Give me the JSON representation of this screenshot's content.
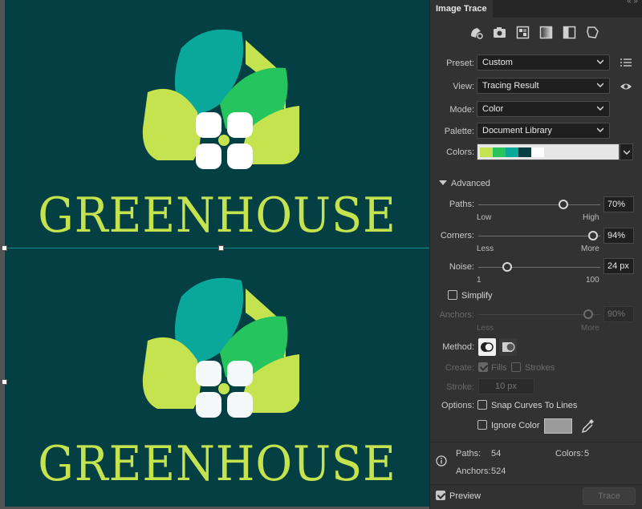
{
  "artwork": {
    "logo_text_top": "GREENHOUSE",
    "logo_text_bottom": "GREENHOUSE",
    "colors": {
      "background": "#033f43",
      "teal": "#0aa79b",
      "green": "#25c45d",
      "lime": "#c5e34f",
      "light_green": "#5dd66a",
      "white": "#ffffff"
    }
  },
  "panel": {
    "title": "Image Trace",
    "presets": [
      "auto-color-icon",
      "high-fidelity-photo-icon",
      "low-fidelity-photo-icon",
      "grayscale-icon",
      "black-and-white-icon",
      "outline-icon"
    ],
    "preset": {
      "label": "Preset:",
      "value": "Custom"
    },
    "view": {
      "label": "View:",
      "value": "Tracing Result"
    },
    "mode": {
      "label": "Mode:",
      "value": "Color"
    },
    "palette": {
      "label": "Palette:",
      "value": "Document Library"
    },
    "colors": {
      "label": "Colors:",
      "swatches": [
        "#c5e34f",
        "#25c45d",
        "#0aa79b",
        "#033f43",
        "#ffffff"
      ]
    },
    "advanced": {
      "label": "Advanced"
    },
    "paths": {
      "label": "Paths:",
      "value": "70%",
      "fraction": 0.7,
      "low": "Low",
      "high": "High"
    },
    "corners": {
      "label": "Corners:",
      "value": "94%",
      "fraction": 0.94,
      "low": "Less",
      "high": "More"
    },
    "noise": {
      "label": "Noise:",
      "value": "24 px",
      "fraction": 0.24,
      "low": "1",
      "high": "100"
    },
    "simplify": {
      "label": "Simplify",
      "checked": false
    },
    "anchors": {
      "label": "Anchors:",
      "value": "90%",
      "fraction": 0.9,
      "low": "Less",
      "high": "More"
    },
    "method": {
      "label": "Method:"
    },
    "create": {
      "label": "Create:",
      "fills": "Fills",
      "strokes": "Strokes"
    },
    "stroke": {
      "label": "Stroke:",
      "value": "10 px"
    },
    "options": {
      "label": "Options:",
      "snap": "Snap Curves To Lines",
      "ignore": "Ignore Color"
    },
    "stats": {
      "paths_label": "Paths:",
      "paths_value": "54",
      "colors_label": "Colors:",
      "colors_value": "5",
      "anchors_label": "Anchors:",
      "anchors_value": "524"
    },
    "preview": {
      "label": "Preview",
      "checked": true
    },
    "trace_button": "Trace"
  }
}
